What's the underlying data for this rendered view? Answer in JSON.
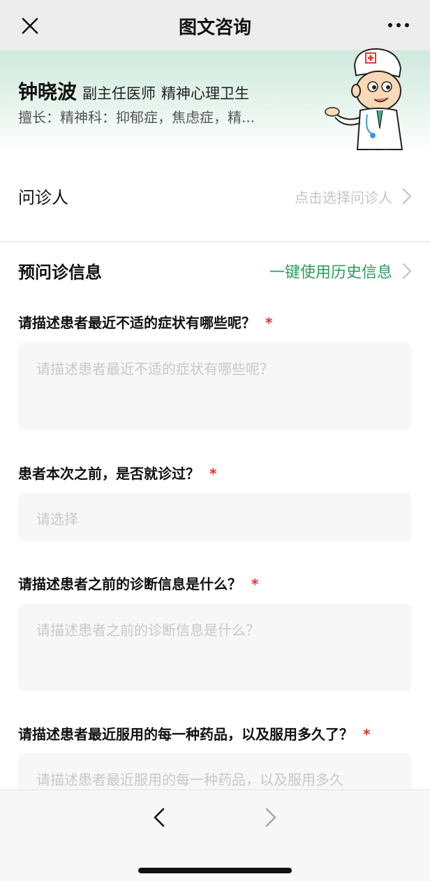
{
  "navbar": {
    "title": "图文咨询",
    "close_icon": "close-icon",
    "more_icon": "more-icon"
  },
  "doctor": {
    "name": "钟晓波",
    "title": "副主任医师",
    "department": "精神心理卫生",
    "specialty": "擅长：精神科：抑郁症，焦虑症，精..."
  },
  "patient": {
    "label": "问诊人",
    "placeholder": "点击选择问诊人"
  },
  "preinfo": {
    "title": "预问诊信息",
    "history_link": "一键使用历史信息"
  },
  "questions": [
    {
      "label": "请描述患者最近不适的症状有哪些呢？",
      "required_mark": "*",
      "placeholder": "请描述患者最近不适的症状有哪些呢？"
    },
    {
      "label": "患者本次之前，是否就诊过？",
      "required_mark": "*",
      "placeholder": "请选择"
    },
    {
      "label": "请描述患者之前的诊断信息是什么？",
      "required_mark": "*",
      "placeholder": "请描述患者之前的诊断信息是什么？"
    },
    {
      "label": "请描述患者最近服用的每一种药品，以及服用多久了？",
      "required_mark": "*",
      "placeholder": "请描述患者最近服用的每一种药品，以及服用多久"
    }
  ],
  "colors": {
    "accent_green": "#2c9b5e",
    "required_red": "#e6322d",
    "banner_green": "#cfe9dd"
  },
  "toolbar": {
    "back_icon": "chevron-left-icon",
    "forward_icon": "chevron-right-icon"
  }
}
